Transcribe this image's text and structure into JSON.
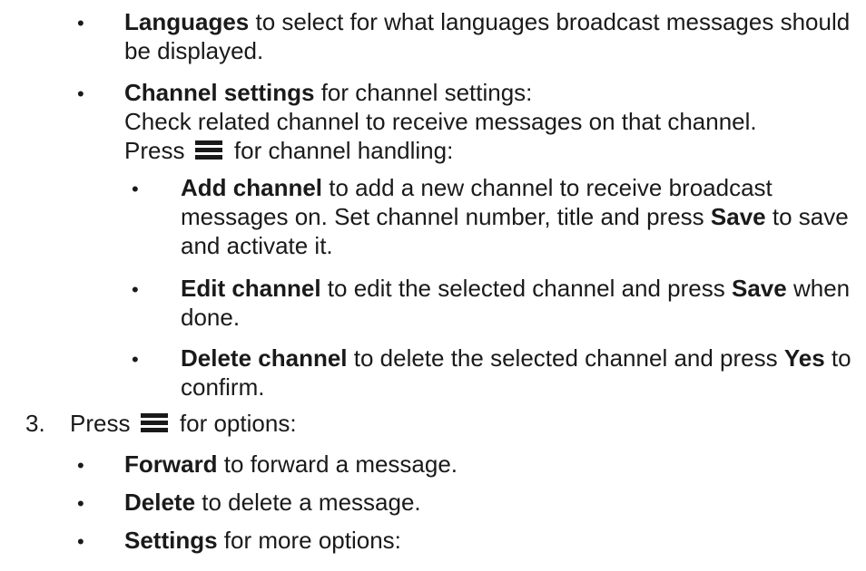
{
  "level1": [
    {
      "term": "Languages",
      "text": " to select for what languages broadcast messages should be displayed."
    },
    {
      "term": "Channel settings",
      "text": " for channel settings:",
      "line2": "Check related channel to receive messages on that channel.",
      "line3_prefix": "Press ",
      "line3_suffix": " for channel handling:"
    }
  ],
  "level2": [
    {
      "term": "Add channel",
      "text": " to add a new channel to receive broadcast messages on. Set channel number, title and press ",
      "term2": "Save",
      "text2": " to save and activate it."
    },
    {
      "term": "Edit channel",
      "text": " to edit the selected channel and press ",
      "term2": "Save",
      "text2": " when done."
    },
    {
      "term": "Delete channel",
      "text": " to delete the selected channel and press ",
      "term2": "Yes",
      "text2": " to confirm."
    }
  ],
  "step3": {
    "number": "3.",
    "prefix": "Press ",
    "suffix": " for options:",
    "items": [
      {
        "term": "Forward",
        "text": " to forward a message."
      },
      {
        "term": "Delete",
        "text": " to delete a message."
      },
      {
        "term": "Settings",
        "text": " for more options:"
      }
    ]
  },
  "icons": {
    "menu": "hamburger-menu-icon"
  },
  "bullet_char": "•"
}
